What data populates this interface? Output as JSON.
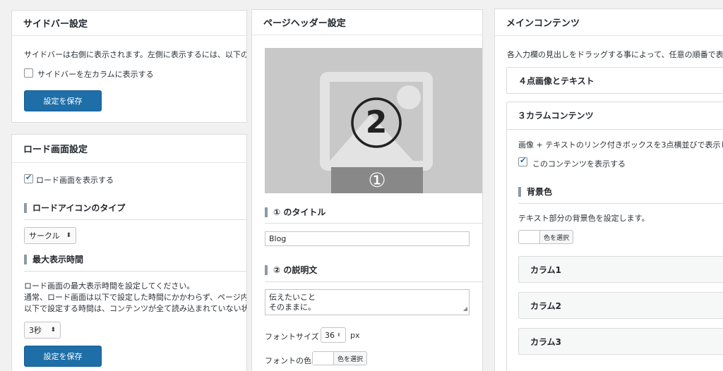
{
  "sidebar_settings": {
    "title": "サイドバー設定",
    "description": "サイドバーは右側に表示されます。左側に表示するには、以下の",
    "checkbox_label": "サイドバーを左カラムに表示する",
    "checkbox_checked": false,
    "save_label": "設定を保存"
  },
  "loading_settings": {
    "title": "ロード画面設定",
    "checkbox_label": "ロード画面を表示する",
    "checkbox_checked": true,
    "icon_type_heading": "ロードアイコンのタイプ",
    "icon_type_value": "サークル",
    "max_time_heading": "最大表示時間",
    "max_time_desc_1": "ロード画面の最大表示時間を設定してください。",
    "max_time_desc_2": "通常、ロード画面は以下で設定した時間にかかわらず、ページ内",
    "max_time_desc_3": "以下で設定する時間は、コンテンツが全て読み込まれていない状",
    "max_time_value": "3秒",
    "save_label": "設定を保存"
  },
  "page_header": {
    "title": "ページヘッダー設定",
    "image_marker_number": "2",
    "image_caption_number": "①",
    "title_heading": "① のタイトル",
    "title_value": "Blog",
    "desc_heading": "② の説明文",
    "desc_value": "伝えたいこと\nそのままに。",
    "font_size_label": "フォントサイズ",
    "font_size_value": "36",
    "font_size_unit": "px",
    "font_color_label": "フォントの色",
    "color_button_label": "色を選択"
  },
  "main_content": {
    "title": "メインコンテンツ",
    "description": "各入力欄の見出しをドラッグする事によって、任意の順番で表示",
    "section_four_points": "４点画像とテキスト",
    "section_three_columns": "３カラムコンテンツ",
    "three_col_desc": "画像 + テキストのリンク付きボックスを3点横並びで表示し",
    "display_checkbox_label": "このコンテンツを表示する",
    "display_checkbox_checked": true,
    "bg_heading": "背景色",
    "bg_desc": "テキスト部分の背景色を設定します。",
    "color_button_label": "色を選択",
    "columns": [
      "カラム1",
      "カラム2",
      "カラム3"
    ]
  },
  "colors": {
    "primary_button": "#1e6ea8",
    "placeholder_bg": "#c8c8c8",
    "placeholder_icon": "#e3e3e3",
    "caption_bar": "#888888"
  }
}
